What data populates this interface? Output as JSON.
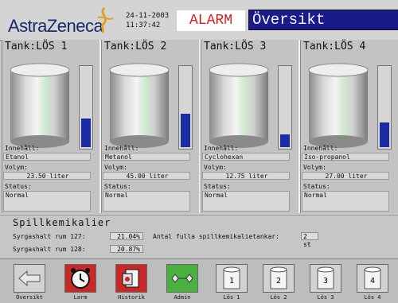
{
  "header": {
    "logo_text": "AstraZeneca",
    "date": "24-11-2003",
    "time": "11:37:42",
    "alarm_label": "ALARM",
    "title": "Översikt"
  },
  "labels": {
    "content": "Innehåll:",
    "volume": "Volym:",
    "status": "Status:"
  },
  "tanks": [
    {
      "title": "Tank:LÖS 1",
      "content": "Etanol",
      "volume": "23.50 liter",
      "status": "Normal",
      "level": 0.35
    },
    {
      "title": "Tank:LÖS 2",
      "content": "Metanol",
      "volume": "45.00 liter",
      "status": "Normal",
      "level": 0.4
    },
    {
      "title": "Tank:LÖS 3",
      "content": "Cyclohexan",
      "volume": "12.75 liter",
      "status": "Normal",
      "level": 0.15
    },
    {
      "title": "Tank:LÖS 4",
      "content": "Iso-propanol",
      "volume": "27.00 liter",
      "status": "Normal",
      "level": 0.3
    }
  ],
  "spill": {
    "title": "Spillkemikalier",
    "room127_label": "Syrgashalt rum 127:",
    "room127_value": "21.04%",
    "room128_label": "Syrgashalt rum 128:",
    "room128_value": "20.87%",
    "full_tanks_label": "Antal fulla spillkemikalietankar:",
    "full_tanks_value": "2 st"
  },
  "toolbar": [
    {
      "label": "Översikt",
      "icon": "arrow-left-icon"
    },
    {
      "label": "Larm",
      "icon": "alarm-clock-icon"
    },
    {
      "label": "Historik",
      "icon": "history-icon"
    },
    {
      "label": "Admin",
      "icon": "wrench-icon"
    },
    {
      "label": "Lös 1",
      "icon": "tank-icon",
      "num": "1"
    },
    {
      "label": "Lös 2",
      "icon": "tank-icon",
      "num": "2"
    },
    {
      "label": "Lös 3",
      "icon": "tank-icon",
      "num": "3"
    },
    {
      "label": "Lös 4",
      "icon": "tank-icon",
      "num": "4"
    }
  ],
  "colors": {
    "title_bg": "#1a1a8a",
    "alarm_text": "#cc2020",
    "level_fill": "#1c2ca2"
  }
}
